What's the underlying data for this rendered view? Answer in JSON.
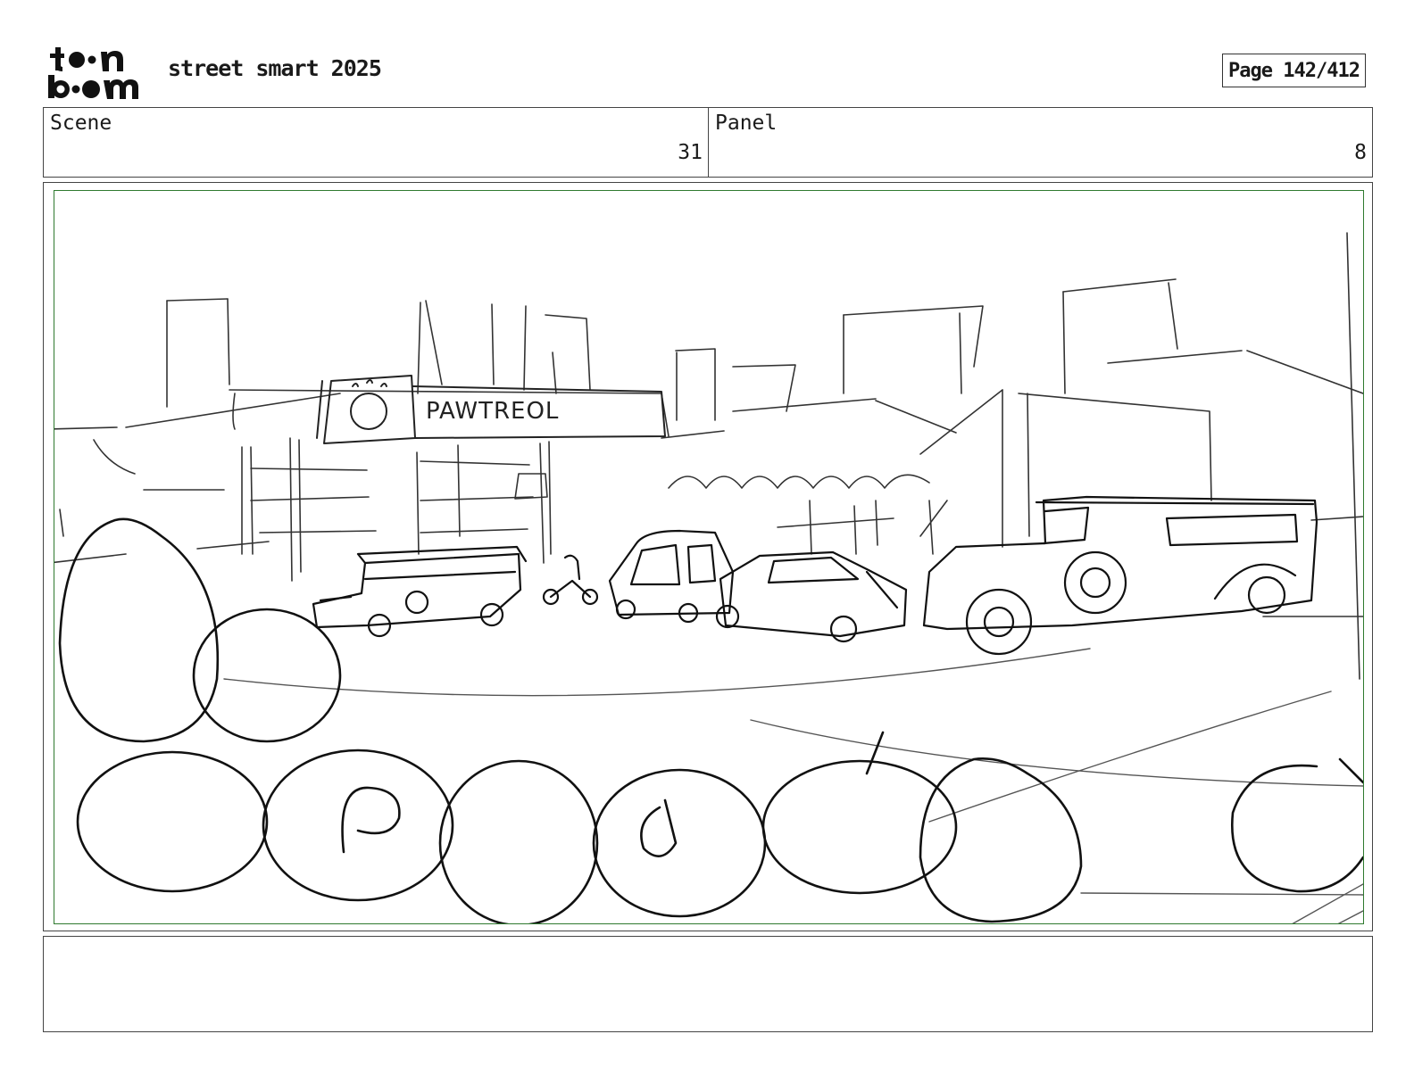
{
  "header": {
    "logo_text_top": "toon",
    "logo_text_bottom": "boom",
    "project_title": "street smart 2025",
    "page_label": "Page 142/412"
  },
  "info": {
    "scene_label": "Scene",
    "scene_value": "31",
    "panel_label": "Panel",
    "panel_value": "8"
  },
  "sketch": {
    "sign_text": "PAWTREOL"
  },
  "caption": {
    "text": ""
  }
}
